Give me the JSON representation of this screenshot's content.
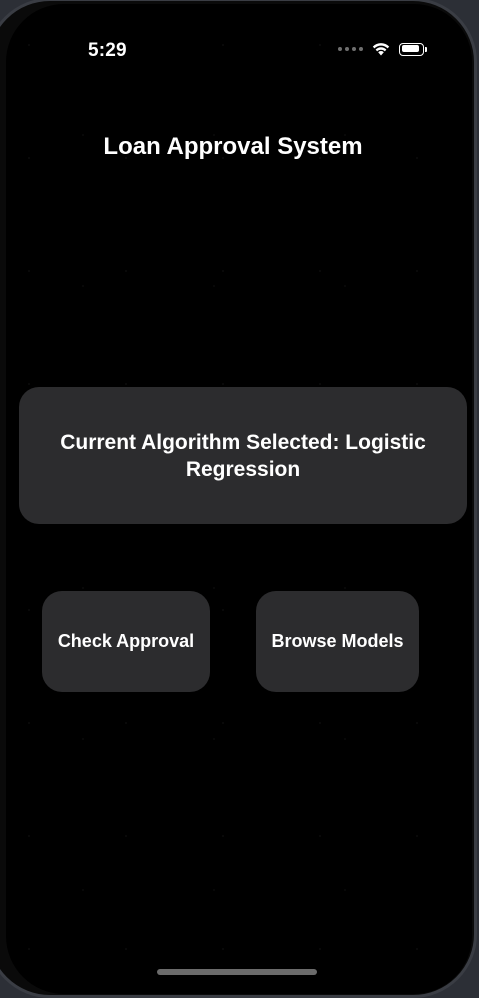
{
  "status_bar": {
    "time": "5:29",
    "signal_icon": "cellular-dots-icon",
    "wifi_icon": "wifi-icon",
    "battery_icon": "battery-icon",
    "battery_level": 0.9
  },
  "screen": {
    "title": "Loan Approval System"
  },
  "algorithm_card": {
    "text": "Current Algorithm Selected: Logistic Regression"
  },
  "actions": {
    "check_approval_label": "Check Approval",
    "browse_models_label": "Browse Models"
  },
  "colors": {
    "background": "#000000",
    "card": "#2c2c2e",
    "text": "#ffffff"
  }
}
